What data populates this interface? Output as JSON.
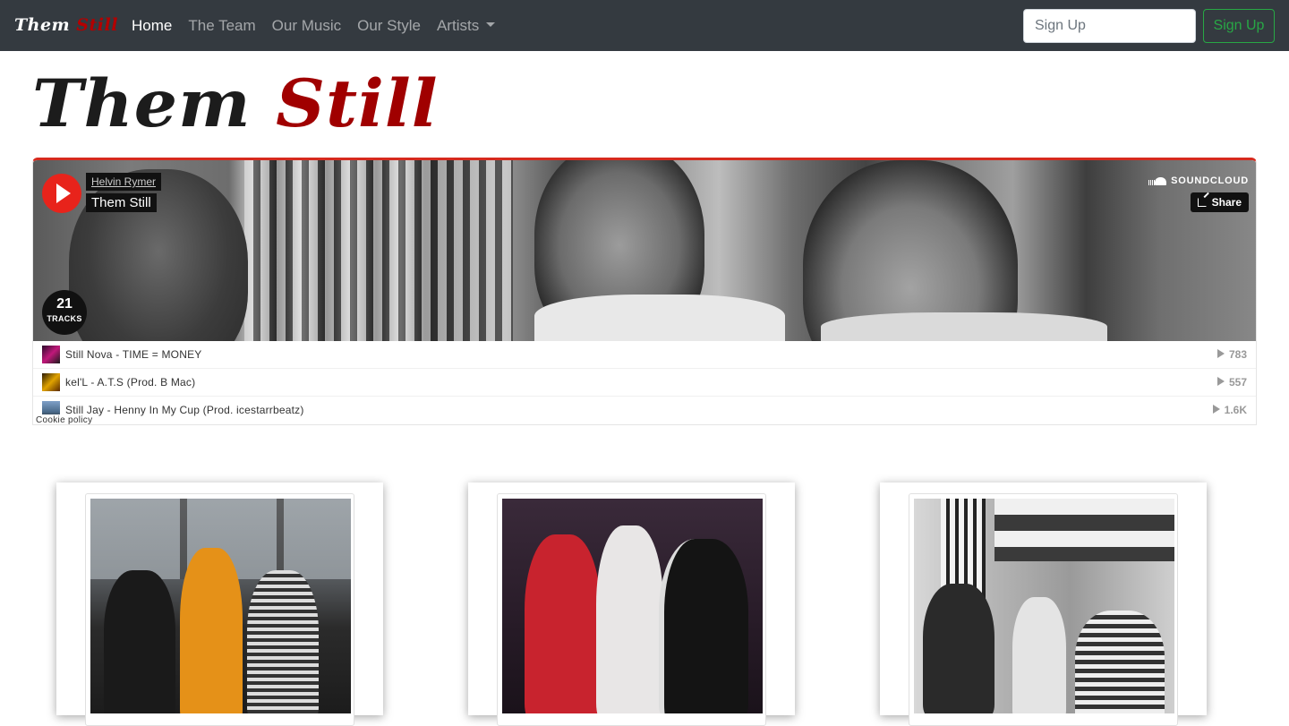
{
  "navbar": {
    "brand_part1": "Them",
    "brand_part2": "Still",
    "links": [
      "Home",
      "The Team",
      "Our Music",
      "Our Style",
      "Artists"
    ],
    "active_link": "Home",
    "signup_placeholder": "Sign Up",
    "signup_button": "Sign Up"
  },
  "hero": {
    "title_part1": "Them",
    "title_part2": "Still"
  },
  "soundcloud": {
    "user": "Helvin Rymer",
    "playlist_title": "Them Still",
    "logo_text": "SOUNDCLOUD",
    "share_label": "Share",
    "tracks_count": "21",
    "tracks_label": "TRACKS",
    "cookie_policy": "Cookie policy",
    "tracks": [
      {
        "name": "Still Nova - TIME = MONEY",
        "plays": "783"
      },
      {
        "name": "kel'L - A.T.S (Prod. B Mac)",
        "plays": "557"
      },
      {
        "name": "Still Jay - Henny In My Cup (Prod. icestarrbeatz)",
        "plays": "1.6K"
      }
    ]
  },
  "colors": {
    "navbar_bg": "#343a40",
    "brand_red": "#a00000",
    "signup_green": "#28a745",
    "soundcloud_orange": "#e8231b"
  }
}
